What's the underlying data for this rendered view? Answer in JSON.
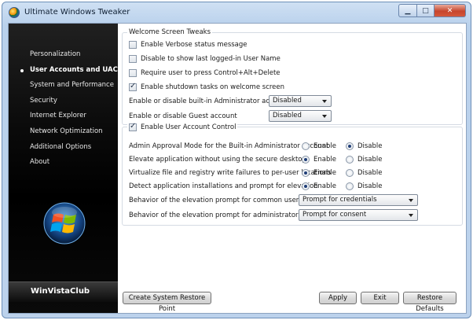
{
  "window": {
    "title": "Ultimate Windows Tweaker"
  },
  "sidebar": {
    "items": [
      {
        "label": "Personalization"
      },
      {
        "label": "User Accounts and UAC"
      },
      {
        "label": "System and Performance"
      },
      {
        "label": "Security"
      },
      {
        "label": "Internet Explorer"
      },
      {
        "label": "Network Optimization"
      },
      {
        "label": "Additional Options"
      },
      {
        "label": "About"
      }
    ],
    "brand": "WinVistaClub"
  },
  "welcome": {
    "title": "Welcome Screen Tweaks",
    "checkboxes": [
      {
        "label": "Enable Verbose status message",
        "checked": false
      },
      {
        "label": "Disable to show last logged-in User Name",
        "checked": false
      },
      {
        "label": "Require user to press Control+Alt+Delete",
        "checked": false
      },
      {
        "label": "Enable shutdown tasks on welcome screen",
        "checked": true
      }
    ],
    "admin_label": "Enable or disable built-in Administrator account",
    "admin_value": "Disabled",
    "guest_label": "Enable or disable Guest account",
    "guest_value": "Disabled"
  },
  "uac": {
    "title": "Enable User Account Control",
    "checked": true,
    "option_enable": "Enable",
    "option_disable": "Disable",
    "settings": [
      {
        "label": "Admin Approval Mode for the Built-in Administrator account",
        "selected": "Disable"
      },
      {
        "label": "Elevate application without using the secure desktop",
        "selected": "Enable"
      },
      {
        "label": "Virtualize file and registry write failures to per-user locations",
        "selected": "Enable"
      },
      {
        "label": "Detect application installations and prompt for elevation",
        "selected": "Enable"
      }
    ],
    "common_label": "Behavior of the elevation prompt for common users",
    "common_value": "Prompt for credentials",
    "admins_label": "Behavior of the elevation prompt for administrators",
    "admins_value": "Prompt for consent"
  },
  "buttons": {
    "restore_point": "Create System Restore Point",
    "apply": "Apply",
    "exit": "Exit",
    "restore_defaults": "Restore Defaults"
  }
}
